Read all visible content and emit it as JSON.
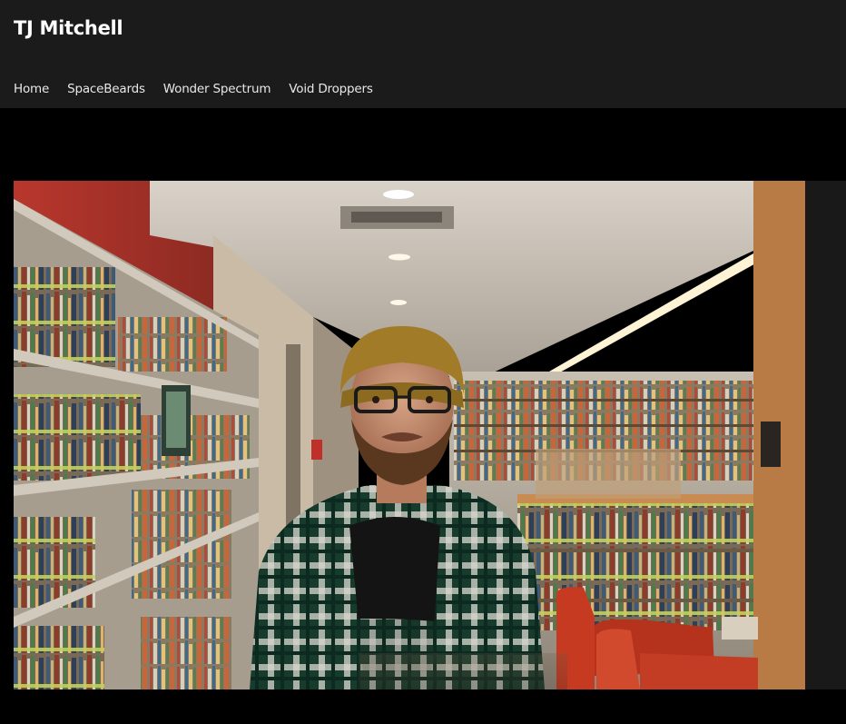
{
  "site": {
    "title": "TJ Mitchell"
  },
  "nav": {
    "items": [
      {
        "label": "Home"
      },
      {
        "label": "SpaceBeards"
      },
      {
        "label": "Wonder Spectrum"
      },
      {
        "label": "Void Droppers"
      }
    ]
  },
  "hero": {
    "image": "library-portrait-photo"
  },
  "colors": {
    "header_bg": "#1b1b1b",
    "page_bg": "#000000",
    "title_text": "#ffffff",
    "nav_text": "#e8e8e8"
  }
}
